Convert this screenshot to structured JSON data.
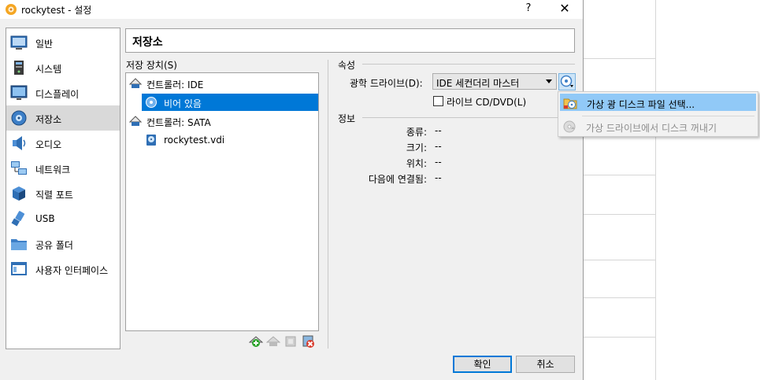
{
  "window": {
    "title": "rockytest - 설정",
    "help_label": "?",
    "close_label": "✕"
  },
  "sidebar": {
    "items": [
      {
        "label": "일반",
        "icon": "general-icon"
      },
      {
        "label": "시스템",
        "icon": "system-icon"
      },
      {
        "label": "디스플레이",
        "icon": "display-icon"
      },
      {
        "label": "저장소",
        "icon": "storage-icon",
        "selected": true
      },
      {
        "label": "오디오",
        "icon": "audio-icon"
      },
      {
        "label": "네트워크",
        "icon": "network-icon"
      },
      {
        "label": "직렬 포트",
        "icon": "serial-port-icon"
      },
      {
        "label": "USB",
        "icon": "usb-icon"
      },
      {
        "label": "공유 폴더",
        "icon": "shared-folder-icon"
      },
      {
        "label": "사용자 인터페이스",
        "icon": "user-interface-icon"
      }
    ]
  },
  "page": {
    "title": "저장소"
  },
  "storage_devices": {
    "label": "저장 장치(S)",
    "tree": [
      {
        "label": "컨트롤러: IDE",
        "icon": "ide-controller-icon"
      },
      {
        "label": "비어 있음",
        "icon": "optical-disc-icon",
        "selected": true
      },
      {
        "label": "컨트롤러: SATA",
        "icon": "sata-controller-icon"
      },
      {
        "label": "rockytest.vdi",
        "icon": "hard-disk-icon"
      }
    ]
  },
  "attributes": {
    "section_label": "속성",
    "optical_drive_label": "광학 드라이브(D):",
    "optical_drive_value": "IDE 세컨더리 마스터",
    "live_cd_label": "라이브 CD/DVD(L)",
    "live_cd_checked": false
  },
  "information": {
    "section_label": "정보",
    "rows": [
      {
        "label": "종류:",
        "value": "--"
      },
      {
        "label": "크기:",
        "value": "--"
      },
      {
        "label": "위치:",
        "value": "--"
      },
      {
        "label": "다음에 연결됨:",
        "value": "--"
      }
    ]
  },
  "buttons": {
    "ok": "확인",
    "cancel": "취소"
  },
  "popup_menu": {
    "items": [
      {
        "label": "가상 광 디스크 파일 선택...",
        "icon": "choose-disk-file-icon",
        "highlighted": true
      },
      {
        "label": "가상 드라이브에서 디스크 꺼내기",
        "icon": "eject-disk-icon",
        "disabled": true
      }
    ]
  }
}
